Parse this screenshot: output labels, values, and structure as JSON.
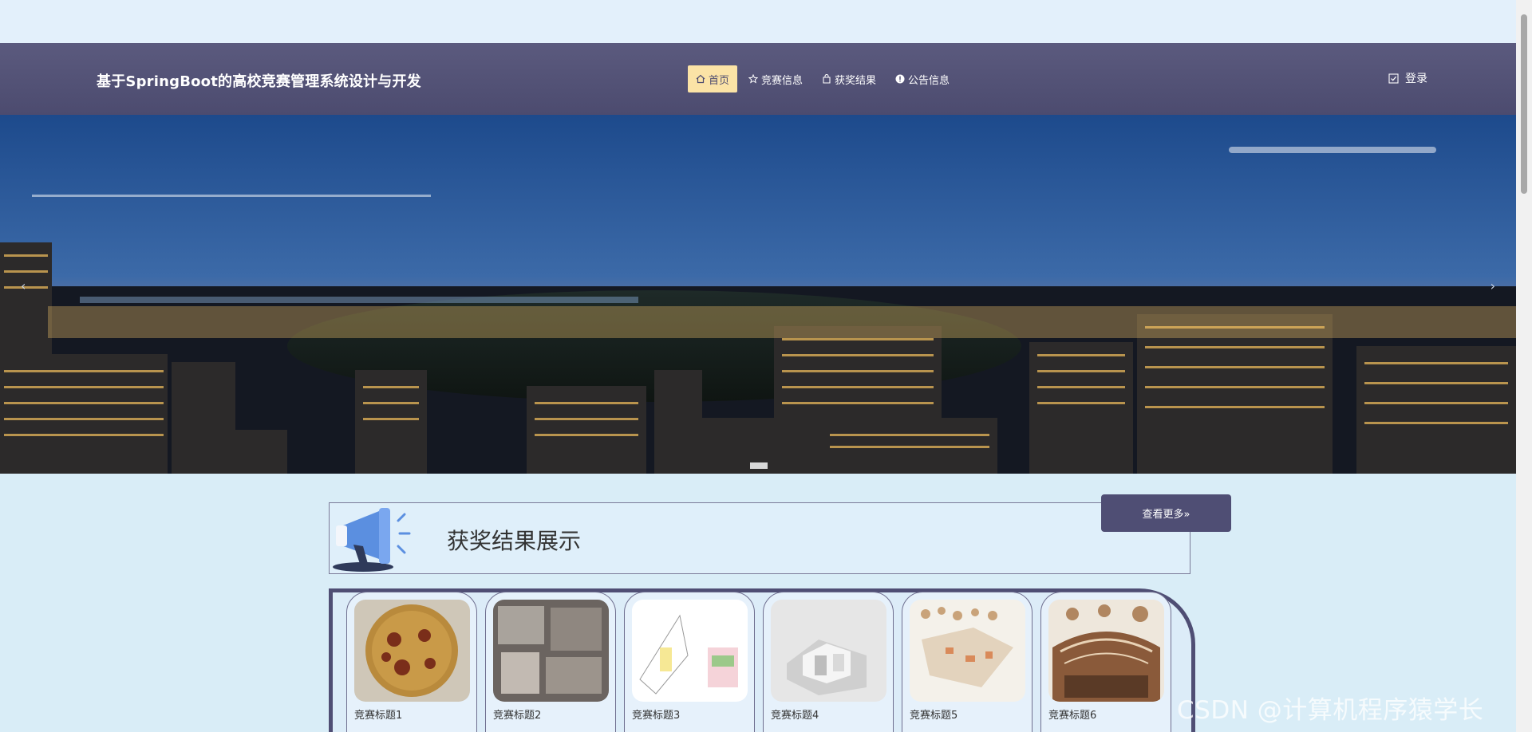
{
  "header": {
    "site_title": "基于SpringBoot的高校竞赛管理系统设计与开发",
    "nav": [
      {
        "label": "首页",
        "icon": "home-icon",
        "active": true
      },
      {
        "label": "竞赛信息",
        "icon": "star-icon",
        "active": false
      },
      {
        "label": "获奖结果",
        "icon": "bag-icon",
        "active": false
      },
      {
        "label": "公告信息",
        "icon": "info-icon",
        "active": false
      }
    ],
    "login_label": "登录"
  },
  "banner": {
    "prev_glyph": "‹",
    "next_glyph": "›"
  },
  "awards_section": {
    "title": "获奖结果展示",
    "more_label": "查看更多»",
    "cards": [
      {
        "title": "竞赛标题1"
      },
      {
        "title": "竞赛标题2"
      },
      {
        "title": "竞赛标题3"
      },
      {
        "title": "竞赛标题4"
      },
      {
        "title": "竞赛标题5"
      },
      {
        "title": "竞赛标题6"
      }
    ]
  },
  "watermark": "CSDN @计算机程序猿学长",
  "colors": {
    "navbar": "#4f4e74",
    "active_nav": "#fbe3a6",
    "page_bg": "#d9edf7"
  }
}
